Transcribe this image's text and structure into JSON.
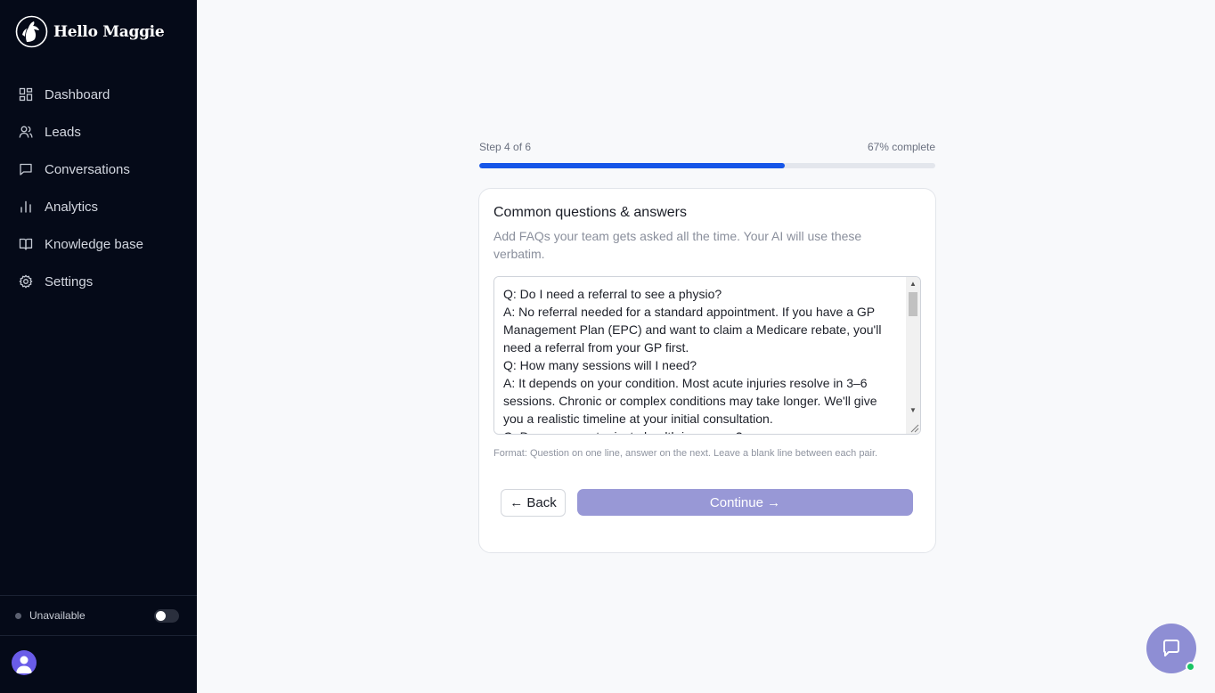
{
  "brand": {
    "name": "Hello Maggie"
  },
  "sidebar": {
    "items": [
      {
        "label": "Dashboard",
        "icon": "grid-icon"
      },
      {
        "label": "Leads",
        "icon": "users-icon"
      },
      {
        "label": "Conversations",
        "icon": "message-square-icon"
      },
      {
        "label": "Analytics",
        "icon": "bar-chart-icon"
      },
      {
        "label": "Knowledge base",
        "icon": "book-open-icon"
      },
      {
        "label": "Settings",
        "icon": "gear-icon"
      }
    ],
    "availability": {
      "label": "Unavailable",
      "enabled": false
    }
  },
  "wizard": {
    "step_text": "Step 4 of 6",
    "percent_text": "67% complete",
    "progress": 0.67
  },
  "card": {
    "title": "Common questions & answers",
    "subtitle": "Add FAQs your team gets asked all the time. Your AI will use these verbatim.",
    "faq_value": "Q: Do I need a referral to see a physio?\nA: No referral needed for a standard appointment. If you have a GP Management Plan (EPC) and want to claim a Medicare rebate, you'll need a referral from your GP first.\nQ: How many sessions will I need?\nA: It depends on your condition. Most acute injuries resolve in 3–6 sessions. Chronic or complex conditions may take longer. We'll give you a realistic timeline at your initial consultation.\nQ: Do you accept private health insurance?",
    "format_hint": "Format: Question on one line, answer on the next. Leave a blank line between each pair.",
    "back_label": "← Back",
    "continue_label": "Continue →"
  },
  "colors": {
    "sidebar_bg": "#050a18",
    "accent": "#1656e8",
    "continue_disabled": "#9898d6",
    "chat_button": "#8e8ed4",
    "online": "#18c463"
  }
}
